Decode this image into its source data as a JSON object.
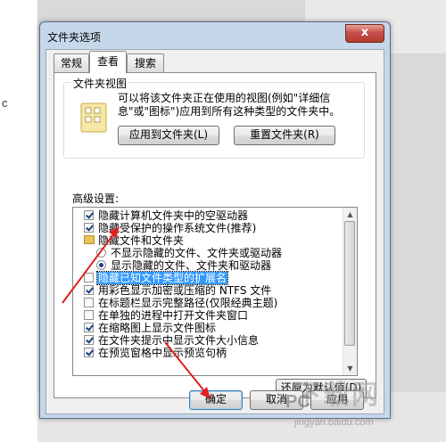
{
  "page_edge_letter": "c",
  "window": {
    "title": "文件夹选项",
    "close_label": "x"
  },
  "tabs": [
    {
      "label": "常规"
    },
    {
      "label": "查看"
    },
    {
      "label": "搜索"
    }
  ],
  "folder_views": {
    "group_title": "文件夹视图",
    "description": "可以将该文件夹正在使用的视图(例如\"详细信息\"或\"图标\")应用到所有这种类型的文件夹中。",
    "apply_button": "应用到文件夹(L)",
    "reset_button": "重置文件夹(R)"
  },
  "advanced": {
    "label": "高级设置:",
    "items": [
      {
        "type": "checkbox",
        "checked": true,
        "label": "隐藏计算机文件夹中的空驱动器"
      },
      {
        "type": "checkbox",
        "checked": true,
        "label": "隐藏受保护的操作系统文件(推荐)"
      },
      {
        "type": "folder",
        "label": "隐藏文件和文件夹"
      },
      {
        "type": "radio",
        "selected": false,
        "label": "不显示隐藏的文件、文件夹或驱动器"
      },
      {
        "type": "radio",
        "selected": true,
        "label": "显示隐藏的文件、文件夹和驱动器"
      },
      {
        "type": "checkbox",
        "checked": false,
        "highlighted": true,
        "label": "隐藏已知文件类型的扩展名"
      },
      {
        "type": "checkbox",
        "checked": true,
        "label": "用彩色显示加密或压缩的 NTFS 文件"
      },
      {
        "type": "checkbox",
        "checked": false,
        "label": "在标题栏显示完整路径(仅限经典主题)"
      },
      {
        "type": "checkbox",
        "checked": false,
        "label": "在单独的进程中打开文件夹窗口"
      },
      {
        "type": "checkbox",
        "checked": true,
        "label": "在缩略图上显示文件图标"
      },
      {
        "type": "checkbox",
        "checked": true,
        "label": "在文件夹提示中显示文件大小信息"
      },
      {
        "type": "checkbox",
        "checked": true,
        "label": "在预览窗格中显示预览句柄"
      }
    ],
    "restore_button": "还原为默认值(D)"
  },
  "footer": {
    "ok_button": "确定",
    "cancel_button": "取消",
    "apply_button": "应用"
  },
  "watermark": {
    "text_top": "下载网",
    "text_mid": "PC",
    "text_bottom": "jingyan.baidu.com"
  },
  "colors": {
    "highlight": "#3399ff",
    "annotation_arrow": "#e02020"
  }
}
